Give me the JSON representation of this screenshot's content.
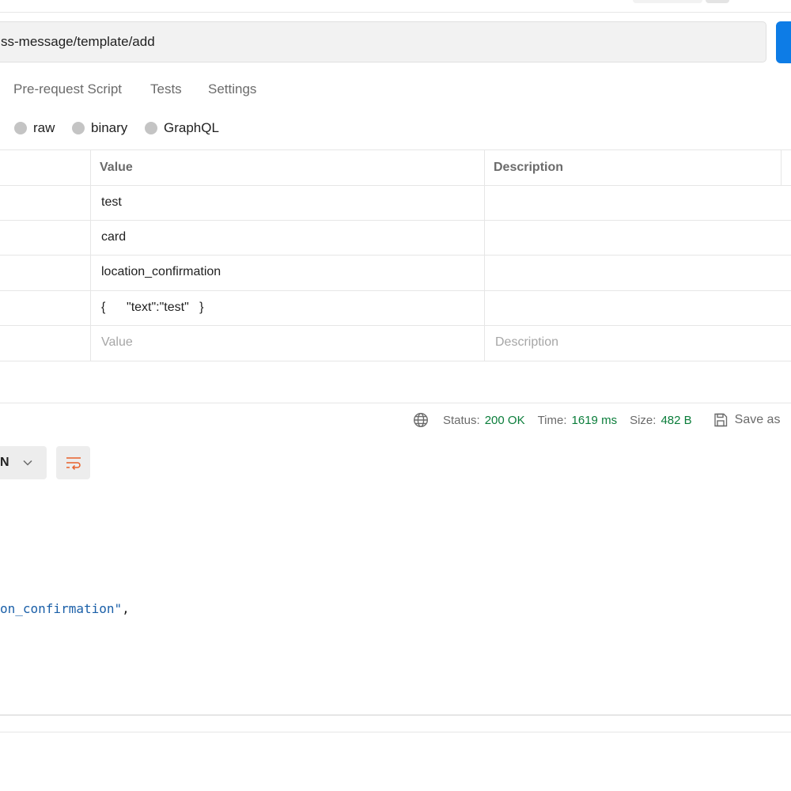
{
  "request": {
    "url": "ss-message/template/add"
  },
  "request_tabs": [
    {
      "label": "Pre-request Script"
    },
    {
      "label": "Tests"
    },
    {
      "label": "Settings"
    }
  ],
  "body_types": [
    {
      "label": "raw"
    },
    {
      "label": "binary"
    },
    {
      "label": "GraphQL"
    }
  ],
  "table": {
    "headers": {
      "value": "Value",
      "description": "Description"
    },
    "rows": [
      {
        "value": "test",
        "description": ""
      },
      {
        "value": "card",
        "description": ""
      },
      {
        "value": "location_confirmation",
        "description": ""
      },
      {
        "value": "{      \"text\":\"test\"   }",
        "description": ""
      }
    ],
    "placeholder": {
      "value": "Value",
      "description": "Description"
    }
  },
  "response": {
    "status_label": "Status:",
    "status_value": "200 OK",
    "time_label": "Time:",
    "time_value": "1619 ms",
    "size_label": "Size:",
    "size_value": "482 B",
    "save_label": "Save as",
    "format_label": "N",
    "code_fragment": "on_confirmation\"",
    "code_punct": ","
  },
  "colors": {
    "accent": "#0d7ce6",
    "status_ok": "#0a7d3a",
    "code_string": "#1a5fa8",
    "wrap_icon": "#e8602a"
  },
  "icons": [
    "globe-icon",
    "save-icon",
    "chevron-down-icon",
    "wrap-lines-icon"
  ]
}
